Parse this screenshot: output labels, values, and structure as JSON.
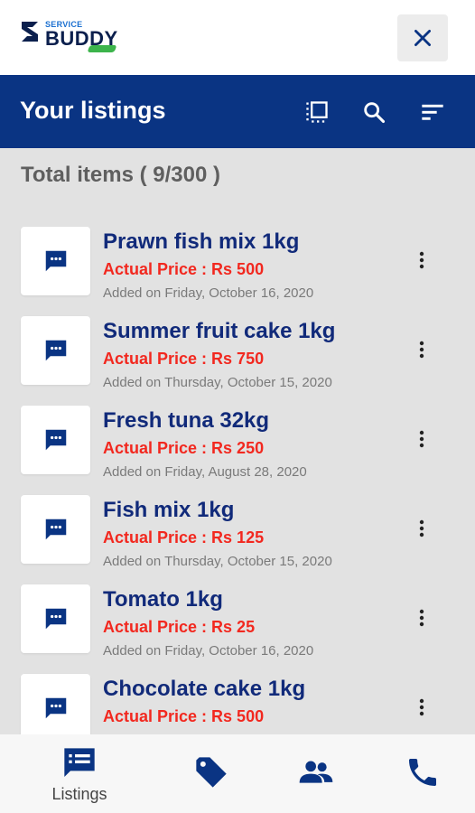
{
  "brand": {
    "small": "SERVICE",
    "big": "BUDDY"
  },
  "header": {
    "title": "Your listings"
  },
  "summary": {
    "total": "Total items ( 9/300 )"
  },
  "listings": [
    {
      "name": "Prawn fish mix 1kg",
      "price": "Actual Price : Rs 500",
      "date": "Added on Friday, October 16, 2020"
    },
    {
      "name": "Summer fruit cake 1kg",
      "price": "Actual Price : Rs 750",
      "date": "Added on Thursday, October 15, 2020"
    },
    {
      "name": "Fresh tuna 32kg",
      "price": "Actual Price : Rs 250",
      "date": "Added on Friday, August 28, 2020"
    },
    {
      "name": "Fish mix 1kg",
      "price": "Actual Price : Rs 125",
      "date": "Added on Thursday, October 15, 2020"
    },
    {
      "name": "Tomato 1kg",
      "price": "Actual Price : Rs 25",
      "date": "Added on Friday, October 16, 2020"
    },
    {
      "name": "Chocolate cake 1kg",
      "price": "Actual Price : Rs 500",
      "date": ""
    }
  ],
  "bottom_nav": {
    "listings_label": "Listings"
  },
  "colors": {
    "primary": "#0a3483",
    "price": "#f2281f",
    "title": "#112a7a",
    "brand_green": "#3cb44b"
  },
  "icons": {
    "close": "close-icon",
    "select": "select-all-icon",
    "search": "search-icon",
    "sort": "sort-icon",
    "thumb": "chat-bubble-icon",
    "more": "more-vert-icon",
    "nav": [
      "listings-icon",
      "tag-icon",
      "people-icon",
      "phone-icon"
    ]
  }
}
